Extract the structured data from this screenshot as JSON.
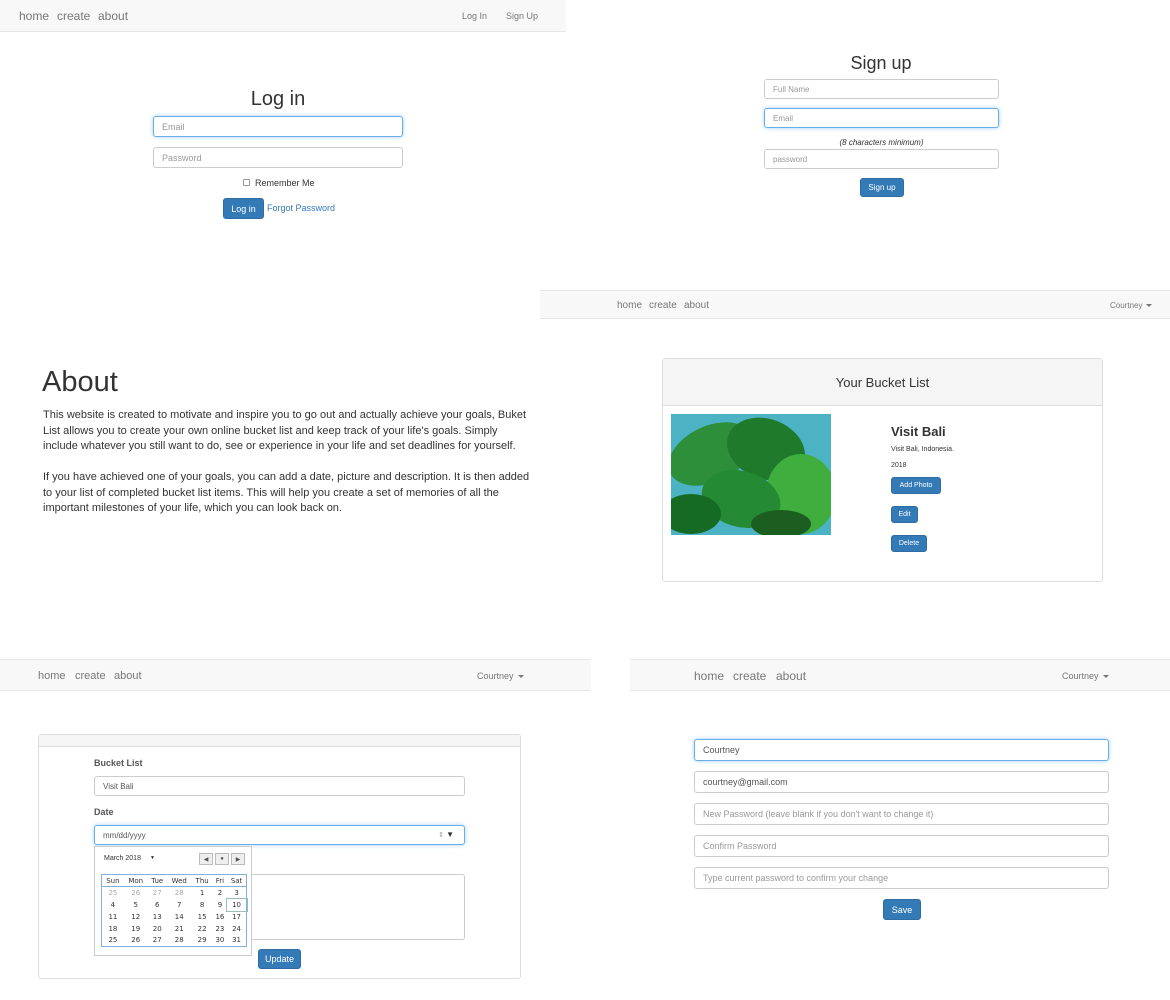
{
  "nav": {
    "home": "home",
    "create": "create",
    "about": "about",
    "login": "Log In",
    "signup": "Sign Up",
    "user": "Courtney"
  },
  "login": {
    "title": "Log in",
    "email_placeholder": "Email",
    "password_placeholder": "Password",
    "remember": "Remember Me",
    "button": "Log in",
    "forgot": "Forgot Password"
  },
  "signup": {
    "title": "Sign up",
    "fullname_placeholder": "Full Name",
    "email_placeholder": "Email",
    "hint": "(8 characters minimum)",
    "password_placeholder": "password",
    "button": "Sign up"
  },
  "about": {
    "title": "About",
    "p1": "This website is created to motivate and inspire you to go out and actually achieve your goals, Buket List allows you to create your own online bucket list and keep track of your life's goals. Simply include whatever you still want to do, see or experience in your life and set deadlines for yourself.",
    "p2": "If you have achieved one of your goals, you can add a date, picture and description. It is then added to your list of completed bucket list items. This will help you create a set of memories of all the important milestones of your life, which you can look back on."
  },
  "bucket": {
    "header": "Your Bucket List",
    "item_title": "Visit Bali",
    "item_location": "Visit Bali, Indonesia.",
    "item_year": "2018",
    "add_photo": "Add Photo",
    "edit": "Edit",
    "delete": "Delete"
  },
  "edit_form": {
    "bucket_label": "Bucket List",
    "bucket_value": "Visit Bali",
    "date_label": "Date",
    "date_placeholder": "mm/dd/yyyy",
    "update": "Update",
    "calendar": {
      "month": "March 2018",
      "weekdays": [
        "Sun",
        "Mon",
        "Tue",
        "Wed",
        "Thu",
        "Fri",
        "Sat"
      ],
      "weeks": [
        [
          "25",
          "26",
          "27",
          "28",
          "1",
          "2",
          "3"
        ],
        [
          "4",
          "5",
          "6",
          "7",
          "8",
          "9",
          "10"
        ],
        [
          "11",
          "12",
          "13",
          "14",
          "15",
          "16",
          "17"
        ],
        [
          "18",
          "19",
          "20",
          "21",
          "22",
          "23",
          "24"
        ],
        [
          "25",
          "26",
          "27",
          "28",
          "29",
          "30",
          "31"
        ]
      ]
    }
  },
  "account": {
    "name_value": "Courtney",
    "email_value": "courtney@gmail.com",
    "new_password_placeholder": "New Password (leave blank if you don't want to change it)",
    "confirm_placeholder": "Confirm Password",
    "current_placeholder": "Type current password to confirm your change",
    "save": "Save"
  },
  "colors": {
    "primary": "#337ab7",
    "navbar": "#f8f8f8",
    "focus": "#66afe9"
  }
}
